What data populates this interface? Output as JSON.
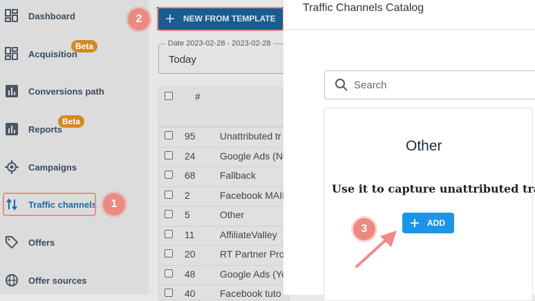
{
  "sidebar": {
    "items": [
      {
        "label": "Dashboard",
        "icon": "dashboard-icon"
      },
      {
        "label": "Acquisition",
        "icon": "acquisition-icon",
        "badge": "Beta"
      },
      {
        "label": "Conversions path",
        "icon": "bar-chart-icon"
      },
      {
        "label": "Reports",
        "icon": "bar-chart-icon",
        "badge": "Beta"
      },
      {
        "label": "Campaigns",
        "icon": "target-icon"
      },
      {
        "label": "Traffic channels",
        "icon": "swap-vertical-icon"
      },
      {
        "label": "Offers",
        "icon": "tag-icon"
      },
      {
        "label": "Offer sources",
        "icon": "globe-icon"
      }
    ]
  },
  "toolbar": {
    "new_from_template_label": "NEW FROM TEMPLATE"
  },
  "date_filter": {
    "legend": "Date 2023-02-28 - 2023-02-28",
    "value": "Today"
  },
  "table": {
    "header_num": "#",
    "rows": [
      {
        "num": "95",
        "name": "Unattributed tr"
      },
      {
        "num": "24",
        "name": "Google Ads (No"
      },
      {
        "num": "68",
        "name": "Fallback"
      },
      {
        "num": "2",
        "name": "Facebook MAIN"
      },
      {
        "num": "5",
        "name": "Other"
      },
      {
        "num": "11",
        "name": "AffiliateValley"
      },
      {
        "num": "20",
        "name": "RT Partner Pro"
      },
      {
        "num": "48",
        "name": "Google Ads (Yo"
      },
      {
        "num": "40",
        "name": "Facebook tuto"
      }
    ]
  },
  "drawer": {
    "title": "Traffic Channels Catalog",
    "search_placeholder": "Search",
    "card": {
      "title": "Other",
      "description": "Use it to capture unattributed traffic",
      "add_label": "ADD"
    }
  },
  "steps": [
    "1",
    "2",
    "3"
  ],
  "colors": {
    "primary": "#1c95e6",
    "step_marker": "#eb8a83",
    "beta_badge": "#d08a24"
  }
}
